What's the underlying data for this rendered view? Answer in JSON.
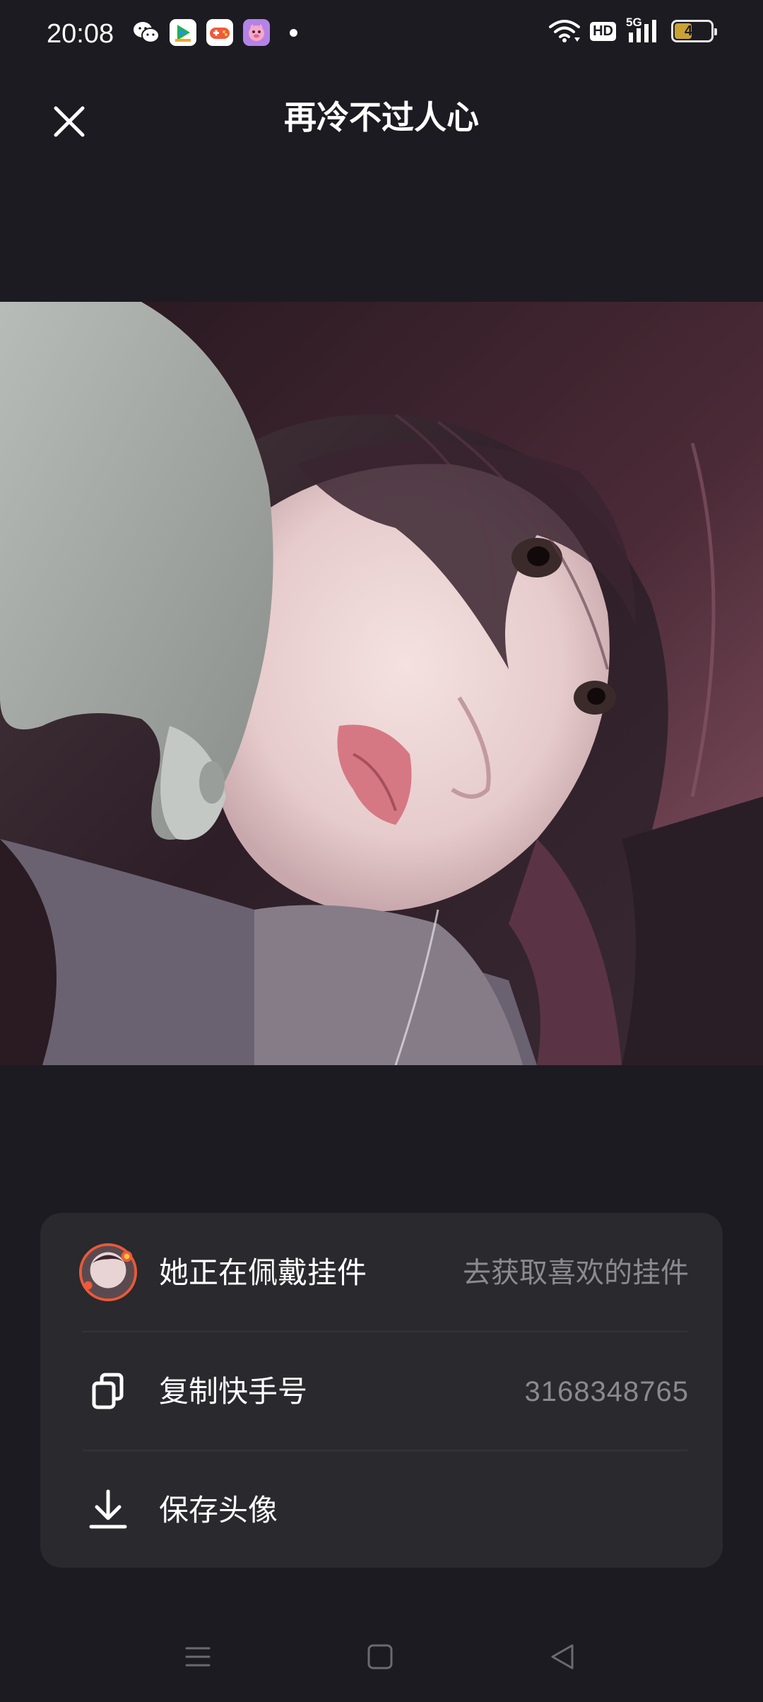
{
  "status_bar": {
    "time": "20:08",
    "network": "5G",
    "hd_label": "HD",
    "battery_level": "48",
    "battery_fraction": 0.48,
    "app_icons": [
      "wechat-icon",
      "tencent-video-icon",
      "game-center-icon",
      "pink-app-icon"
    ]
  },
  "header": {
    "title": "再冷不过人心",
    "close_icon": "close-icon"
  },
  "sheet": {
    "pendant": {
      "label": "她正在佩戴挂件",
      "value": "去获取喜欢的挂件"
    },
    "copy_id": {
      "label": "复制快手号",
      "value": "3168348765"
    },
    "save_avatar": {
      "label": "保存头像"
    }
  },
  "nav_bar": {
    "icons": [
      "menu-icon",
      "home-icon",
      "back-icon"
    ]
  },
  "colors": {
    "background": "#1c1b21",
    "sheet": "#29292e",
    "muted_text": "#8a8a90",
    "battery_fill": "#c9a233"
  }
}
